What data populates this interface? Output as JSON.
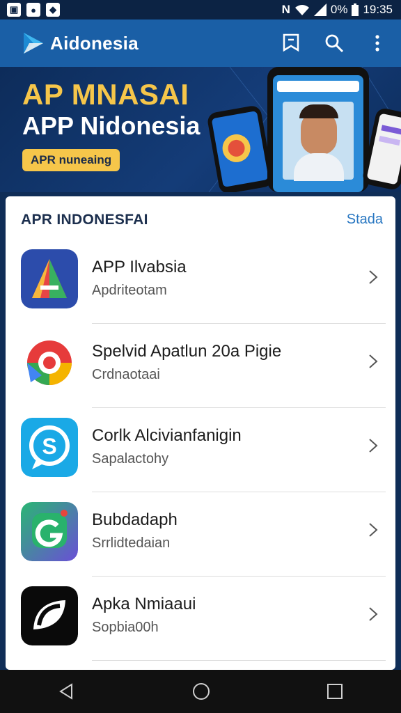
{
  "status_bar": {
    "battery_pct": "0%",
    "time": "19:35"
  },
  "app_bar": {
    "title": "Aidonesia",
    "icons": [
      "bookmark-icon",
      "search-icon",
      "more-icon"
    ]
  },
  "banner": {
    "headline1": "AP MNASAI",
    "headline2": "APP Nidonesia",
    "pill": "APR nuneaing"
  },
  "section": {
    "title": "APR INDONESFAI",
    "link": "Stada"
  },
  "apps": [
    {
      "name": "APP Ilvabsia",
      "subtitle": "Apdriteotam"
    },
    {
      "name": "Spelvid Apatlun 20a Pigie",
      "subtitle": "Crdnaotaai"
    },
    {
      "name": "Corlk Alcivianfanigin",
      "subtitle": "Sapalactohy"
    },
    {
      "name": "Bubdadaph",
      "subtitle": "Srrlidtedaian"
    },
    {
      "name": "Apka Nmiaaui",
      "subtitle": "Sopbia00h"
    }
  ],
  "colors": {
    "app_bar": "#1a5fa6",
    "status_bar": "#0c2344",
    "banner_accent": "#f6c64a",
    "link": "#2a78c2"
  }
}
